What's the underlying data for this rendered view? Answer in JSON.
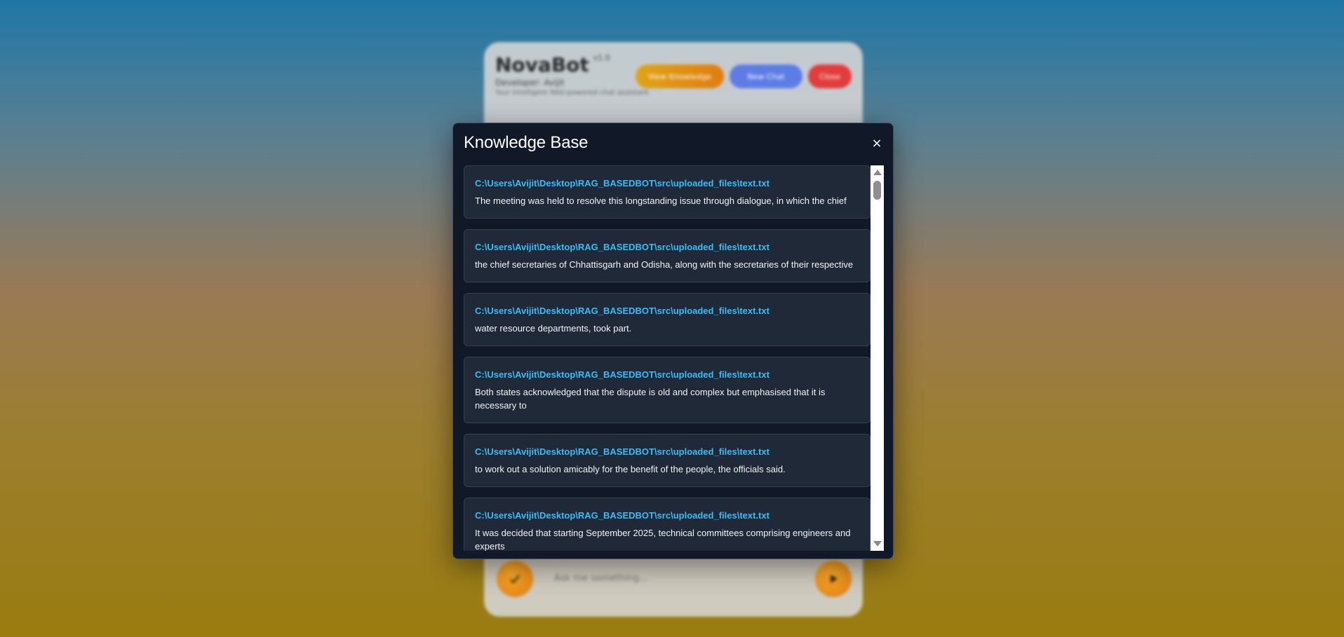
{
  "background_app": {
    "title": "NovaBot",
    "version": "v1.0",
    "subtitle": "Developer: Avijit",
    "tagline": "Your intelligent RAG-powered chat assistant",
    "buttons": {
      "knowledge_base": "View Knowledge",
      "new_chat": "New Chat",
      "close": "Close"
    },
    "input_placeholder": "Ask me something...",
    "upload_icon": "upload-icon",
    "send_icon": "send-icon"
  },
  "modal": {
    "title": "Knowledge Base",
    "close_label": "×",
    "entries": [
      {
        "path": "C:\\Users\\Avijit\\Desktop\\RAG_BASEDBOT\\src\\uploaded_files\\text.txt",
        "text": "The meeting was held to resolve this longstanding issue through dialogue, in which the chief"
      },
      {
        "path": "C:\\Users\\Avijit\\Desktop\\RAG_BASEDBOT\\src\\uploaded_files\\text.txt",
        "text": "the chief secretaries of Chhattisgarh and Odisha, along with the secretaries of their respective"
      },
      {
        "path": "C:\\Users\\Avijit\\Desktop\\RAG_BASEDBOT\\src\\uploaded_files\\text.txt",
        "text": "water resource departments, took part."
      },
      {
        "path": "C:\\Users\\Avijit\\Desktop\\RAG_BASEDBOT\\src\\uploaded_files\\text.txt",
        "text": "Both states acknowledged that the dispute is old and complex but emphasised that it is necessary to"
      },
      {
        "path": "C:\\Users\\Avijit\\Desktop\\RAG_BASEDBOT\\src\\uploaded_files\\text.txt",
        "text": "to work out a solution amicably for the benefit of the people, the officials said."
      },
      {
        "path": "C:\\Users\\Avijit\\Desktop\\RAG_BASEDBOT\\src\\uploaded_files\\text.txt",
        "text": "It was decided that starting September 2025, technical committees comprising engineers and experts"
      }
    ]
  },
  "colors": {
    "modal_bg": "#111827",
    "entry_bg": "#1f2937",
    "path_color": "#38bdf8",
    "text_color": "#f3f4f6"
  }
}
